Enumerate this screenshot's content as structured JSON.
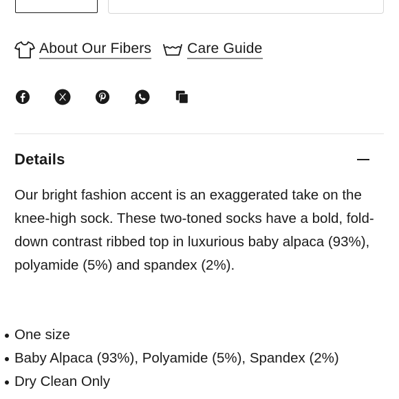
{
  "links": {
    "fibers_label": "About Our Fibers",
    "care_label": "Care Guide"
  },
  "share": {
    "icons": [
      "facebook-icon",
      "x-icon",
      "pinterest-icon",
      "whatsapp-icon",
      "copy-link-icon"
    ]
  },
  "details": {
    "title": "Details",
    "description": "Our bright fashion accent is an exaggerated take on the knee-high sock. These two-toned socks have a bold, fold-down contrast ribbed top in luxurious baby alpaca (93%), polyamide (5%) and spandex (2%).",
    "bullets": [
      "One size",
      "Baby Alpaca (93%), Polyamide (5%), Spandex (2%)",
      "Dry Clean Only"
    ]
  },
  "colors": {
    "text": "#1a1a1a",
    "divider": "#e3e3e3",
    "underline": "#8a8a8a"
  }
}
